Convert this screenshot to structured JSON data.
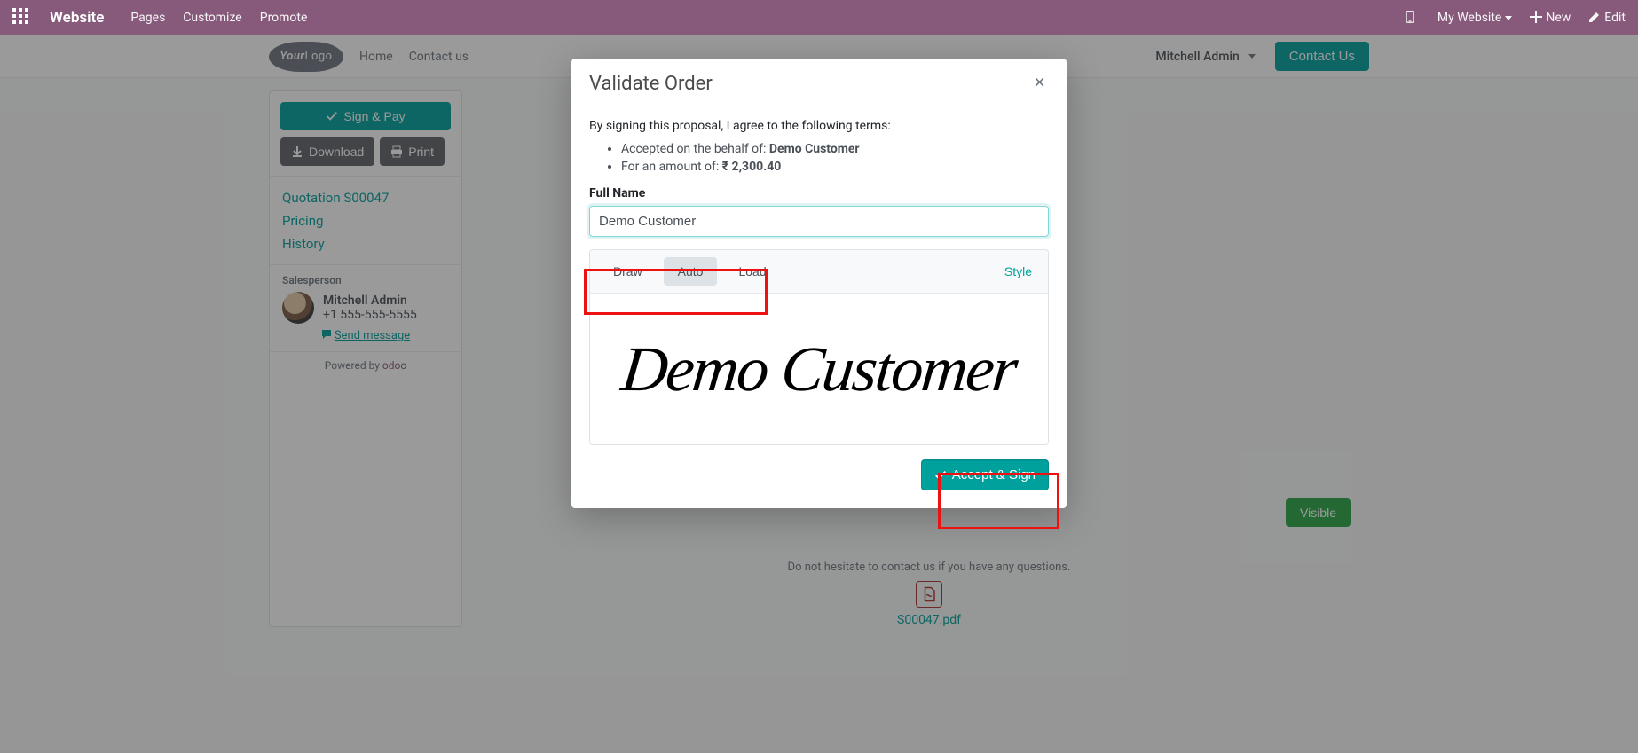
{
  "topbar": {
    "brand": "Website",
    "pages": "Pages",
    "customize": "Customize",
    "promote": "Promote",
    "my_website": "My Website",
    "new": "New",
    "edit": "Edit"
  },
  "siteheader": {
    "logo_line1": "Your",
    "logo_line2": "Logo",
    "home": "Home",
    "contact_us_link": "Contact us",
    "user": "Mitchell Admin",
    "contact_button": "Contact Us"
  },
  "sidebar": {
    "sign_pay": "Sign & Pay",
    "download": "Download",
    "print": "Print",
    "links": {
      "quotation": "Quotation S00047",
      "pricing": "Pricing",
      "history": "History"
    },
    "salesperson_label": "Salesperson",
    "sp_name": "Mitchell Admin",
    "sp_phone": "+1 555-555-5555",
    "send_message": "Send message",
    "powered_prefix": "Powered by ",
    "powered_brand": "odoo"
  },
  "page": {
    "contact_note": "Do not hesitate to contact us if you have any questions.",
    "pdf_name": "S00047.pdf",
    "visible_btn": "Visible"
  },
  "modal": {
    "title": "Validate Order",
    "intro": "By signing this proposal, I agree to the following terms:",
    "behalf_label": "Accepted on the behalf of: ",
    "behalf_value": "Demo Customer",
    "amount_label": "For an amount of: ",
    "amount_value": "₹ 2,300.40",
    "full_name_label": "Full Name",
    "full_name_value": "Demo Customer",
    "tabs": {
      "draw": "Draw",
      "auto": "Auto",
      "load": "Load"
    },
    "style": "Style",
    "signature_text": "Demo Customer",
    "accept": "Accept & Sign"
  }
}
